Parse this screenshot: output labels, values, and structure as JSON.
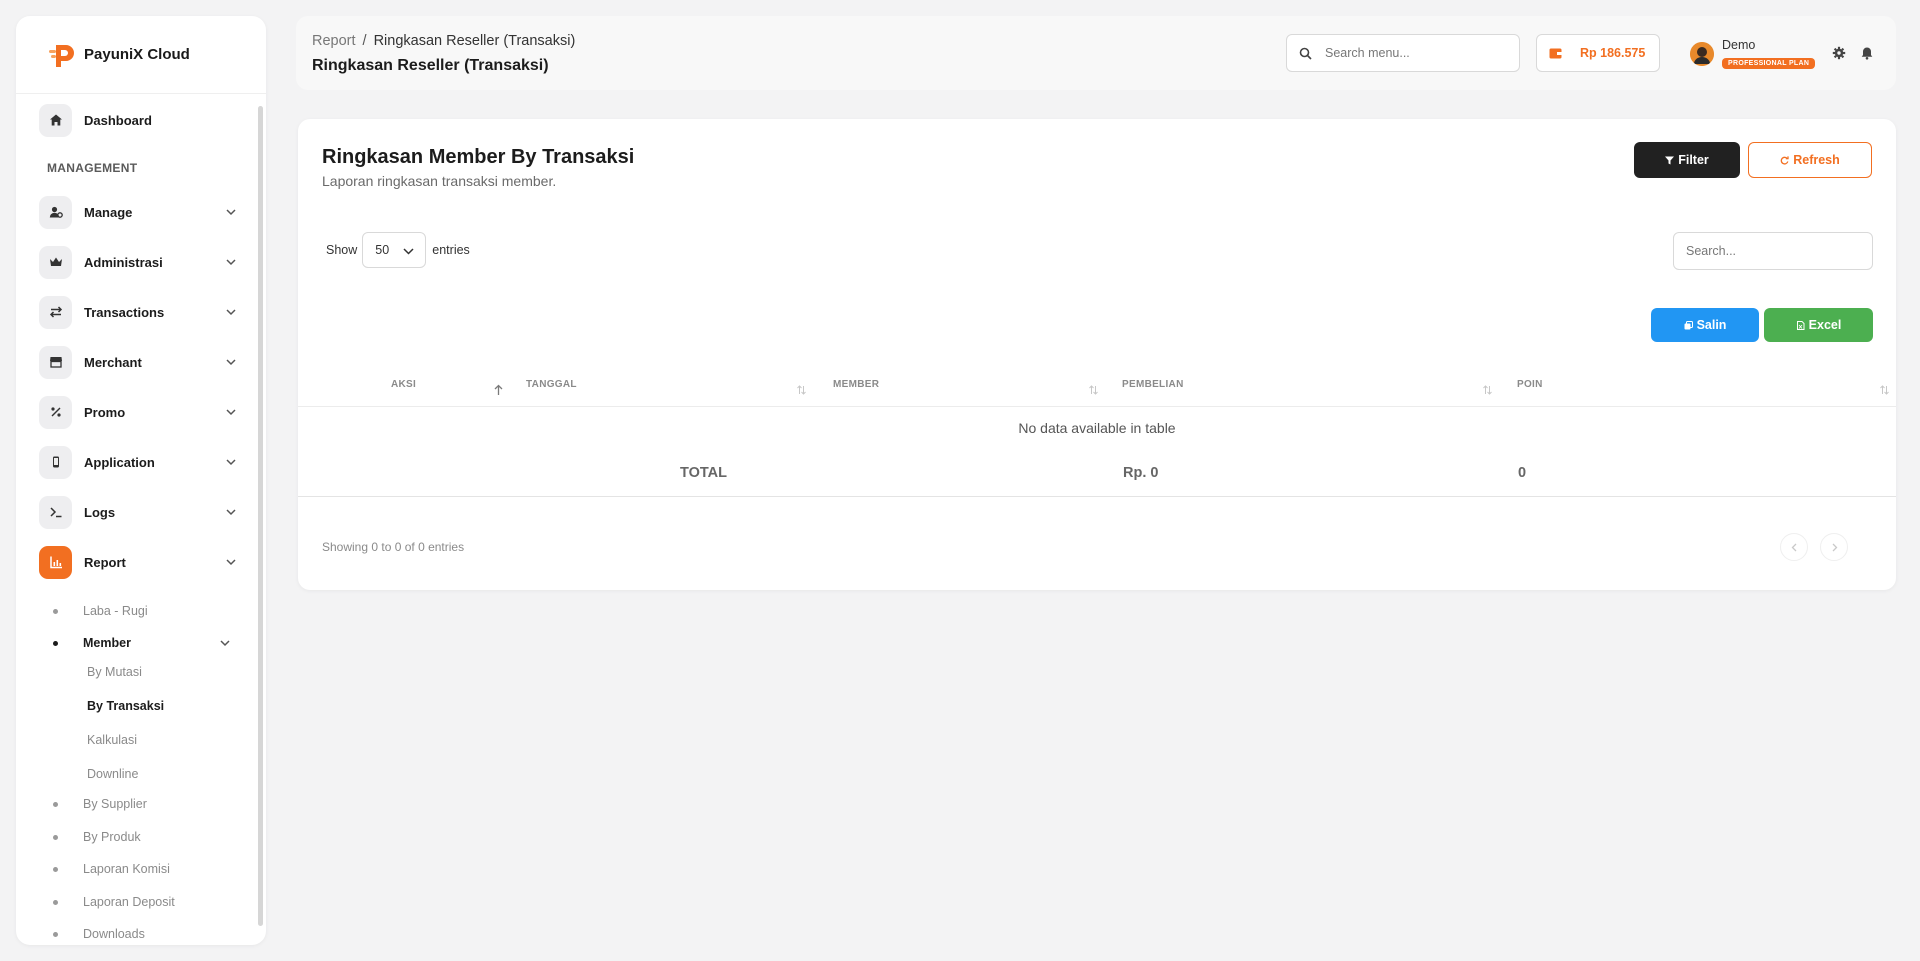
{
  "app": {
    "name": "PayuniX Cloud"
  },
  "sidebar": {
    "section_label": "MANAGEMENT",
    "items": [
      {
        "label": "Dashboard",
        "icon": "home-icon"
      },
      {
        "label": "Manage",
        "icon": "user-cog-icon"
      },
      {
        "label": "Administrasi",
        "icon": "crown-icon"
      },
      {
        "label": "Transactions",
        "icon": "swap-icon"
      },
      {
        "label": "Merchant",
        "icon": "store-icon"
      },
      {
        "label": "Promo",
        "icon": "percent-icon"
      },
      {
        "label": "Application",
        "icon": "mobile-icon"
      },
      {
        "label": "Logs",
        "icon": "terminal-icon"
      },
      {
        "label": "Report",
        "icon": "chart-icon"
      }
    ],
    "report_sub": [
      {
        "label": "Laba - Rugi"
      },
      {
        "label": "Member"
      },
      {
        "label": "By Supplier"
      },
      {
        "label": "By Produk"
      },
      {
        "label": "Laporan Komisi"
      },
      {
        "label": "Laporan Deposit"
      },
      {
        "label": "Downloads"
      }
    ],
    "member_sub": [
      {
        "label": "By Mutasi"
      },
      {
        "label": "By Transaksi"
      },
      {
        "label": "Kalkulasi"
      },
      {
        "label": "Downline"
      }
    ]
  },
  "header": {
    "breadcrumb": {
      "root": "Report",
      "separator": "/",
      "current": "Ringkasan Reseller (Transaksi)"
    },
    "title": "Ringkasan Reseller (Transaksi)",
    "search_placeholder": "Search menu...",
    "balance": "Rp 186.575",
    "user": {
      "name": "Demo",
      "plan": "PROFESSIONAL PLAN"
    }
  },
  "card": {
    "title": "Ringkasan Member By Transaksi",
    "subtitle": "Laporan ringkasan transaksi member.",
    "filter_label": "Filter",
    "refresh_label": "Refresh",
    "show_label": "Show",
    "entries_value": "50",
    "entries_label": "entries",
    "search_placeholder": "Search...",
    "salin_label": "Salin",
    "excel_label": "Excel",
    "columns": [
      "AKSI",
      "TANGGAL",
      "MEMBER",
      "PEMBELIAN",
      "POIN"
    ],
    "empty_text": "No data available in table",
    "total": {
      "label": "TOTAL",
      "pembelian": "Rp. 0",
      "poin": "0"
    },
    "info": "Showing 0 to 0 of 0 entries"
  },
  "colors": {
    "accent": "#f26f21",
    "filter_bg": "#212121",
    "salin_bg": "#2196f3",
    "excel_bg": "#4caf50"
  }
}
